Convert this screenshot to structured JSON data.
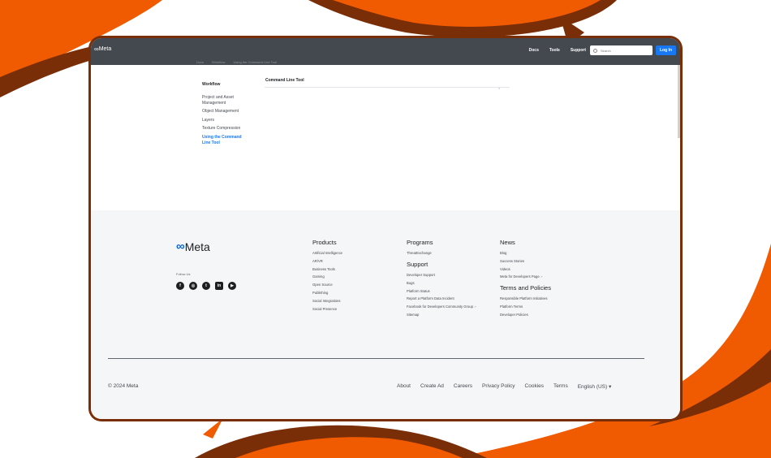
{
  "colors": {
    "accent_orange": "#f05a00",
    "dark_brown": "#7a2e08",
    "nav_bg": "#444950",
    "link_blue": "#1877f2",
    "footer_bg": "#f5f6f7"
  },
  "topnav": {
    "logo_text": "Meta",
    "links": [
      "Docs",
      "Tools",
      "Support"
    ],
    "search_placeholder": "Search",
    "login_label": "Log In"
  },
  "breadcrumb": [
    "Docs",
    "Workflow",
    "Using the Command Line Tool"
  ],
  "sidebar": {
    "heading": "Workflow",
    "items": [
      {
        "label": "Project and Asset Management"
      },
      {
        "label": "Object Management"
      },
      {
        "label": "Layers"
      },
      {
        "label": "Texture Compression"
      },
      {
        "label": "Using the Command Line Tool"
      }
    ]
  },
  "content": {
    "title": "Command Line Tool",
    "collapse_icon": "chevron-up-icon"
  },
  "footer": {
    "logo_text": "Meta",
    "follow_label": "Follow Us",
    "social_icons": [
      "facebook-icon",
      "instagram-icon",
      "twitter-icon",
      "linkedin-icon",
      "youtube-icon"
    ],
    "products": {
      "heading": "Products",
      "links": [
        "Artificial Intelligence",
        "AR/VR",
        "Business Tools",
        "Gaming",
        "Open Source",
        "Publishing",
        "Social Integrations",
        "Social Presence"
      ]
    },
    "programs": {
      "heading": "Programs",
      "links": [
        "ThreatExchange"
      ]
    },
    "support": {
      "heading": "Support",
      "links": [
        "Developer Support",
        "Bugs",
        "Platform Status",
        "Report a Platform Data Incident",
        "Facebook for Developers Community Group",
        "Sitemap"
      ]
    },
    "news": {
      "heading": "News",
      "links": [
        "Blog",
        "Success Stories",
        "Videos",
        "Meta for Developers Page"
      ]
    },
    "terms": {
      "heading": "Terms and Policies",
      "links": [
        "Responsible Platform Initiatives",
        "Platform Terms",
        "Developer Policies"
      ]
    },
    "copyright": "© 2024 Meta",
    "bottom_links": [
      "About",
      "Create Ad",
      "Careers",
      "Privacy Policy",
      "Cookies",
      "Terms",
      "English (US) ▾"
    ]
  }
}
